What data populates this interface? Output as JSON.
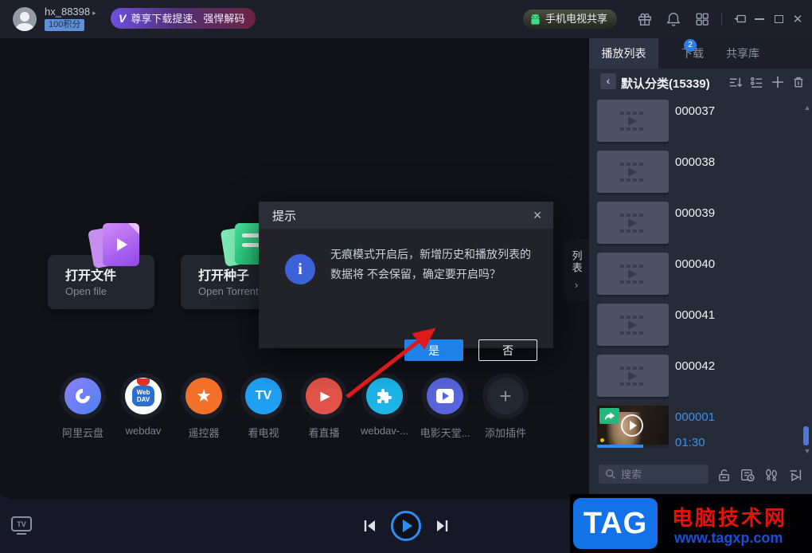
{
  "topbar": {
    "username": "hx_88398",
    "points_badge": "100积分",
    "promo_label": "尊享下载提速、强悍解码",
    "share_label": "手机电视共享"
  },
  "main": {
    "open_file_title": "打开文件",
    "open_file_subtitle": "Open file",
    "open_torrent_title": "打开种子",
    "open_torrent_subtitle": "Open Torrent",
    "plugins": [
      {
        "label": "阿里云盘"
      },
      {
        "label": "webdav",
        "glyph_line1": "Web",
        "glyph_line2": "DAV"
      },
      {
        "label": "遥控器",
        "glyph": "★"
      },
      {
        "label": "看电视",
        "glyph": "TV"
      },
      {
        "label": "看直播",
        "glyph": "▶"
      },
      {
        "label": "webdav-..."
      },
      {
        "label": "电影天堂..."
      },
      {
        "label": "添加插件",
        "glyph": "+"
      }
    ],
    "list_side_tab": "列表",
    "side_tab_chevron": "›"
  },
  "dialog": {
    "title": "提示",
    "close_glyph": "✕",
    "info_glyph": "i",
    "message_line1": "无痕模式开启后，新增历史和播放列表的数据将",
    "message_line2": "不会保留，确定要开启吗？",
    "yes_label": "是",
    "no_label": "否"
  },
  "playlist": {
    "tabs": [
      {
        "label": "播放列表"
      },
      {
        "label": "下载",
        "badge": "2"
      },
      {
        "label": "共享库"
      }
    ],
    "back_glyph": "‹",
    "category_title": "默认分类(15339)",
    "items": [
      {
        "name": "000037"
      },
      {
        "name": "000038"
      },
      {
        "name": "000039"
      },
      {
        "name": "000040"
      },
      {
        "name": "000041"
      },
      {
        "name": "000042"
      }
    ],
    "current": {
      "name": "000001",
      "duration": "01:30"
    },
    "search_placeholder": "搜索",
    "scroll_up_glyph": "▲",
    "scroll_down_glyph": "▼"
  },
  "player": {
    "tv_badge": "TV"
  },
  "watermark": {
    "logo": "TAG",
    "site": "电脑技术网",
    "url": "www.tagxp.com"
  },
  "colors": {
    "accent_blue": "#1e82e8",
    "highlight_text": "#3d8fe8",
    "badge_green": "#23b87c",
    "arrow_red": "#dd1a1a",
    "panel": "#262b38"
  }
}
